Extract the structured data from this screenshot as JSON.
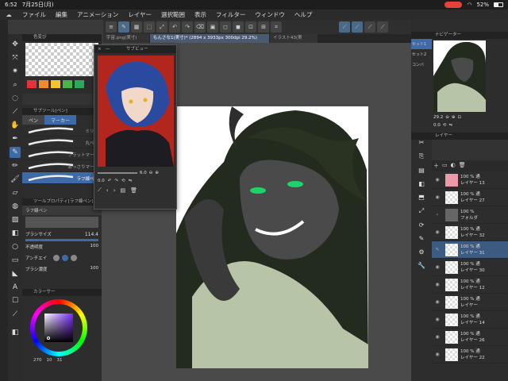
{
  "status": {
    "time": "6:52",
    "date": "7月25日(月)",
    "battery": "52%"
  },
  "menu": [
    "ファイル",
    "編集",
    "アニメーション",
    "レイヤー",
    "選択範囲",
    "表示",
    "フィルター",
    "ウィンドウ",
    "ヘルプ"
  ],
  "tabs": [
    "宇宙.png(実寸)",
    "もんさな1(実寸)* (2894 x 3933px 300dpi 29.2%)",
    "イラスト43(実"
  ],
  "color_set": {
    "title": "色変び",
    "swatches": [
      "#e8303a",
      "#f08a2c",
      "#f3c531",
      "#48b64a",
      "#2aa95b"
    ]
  },
  "subtool": {
    "title": "サブツール[ペン]",
    "tabs": [
      "ペン",
      "マーカー"
    ],
    "brushes": [
      "ミリペ",
      "丸ペン",
      "フラットマーカ",
      "あっさりマーカ",
      "ラフ線ペン"
    ]
  },
  "tool_property": {
    "title": "ツールプロパティ[ラフ線ペン]",
    "name": "ラフ線ペン",
    "brush_size_label": "ブラシサイズ",
    "brush_size": "114.4",
    "opacity_label": "不透明度",
    "opacity": "100",
    "antialias_label": "アンチエイ",
    "density_label": "ブラシ濃度",
    "density": "100"
  },
  "color_wheel": {
    "title": "カラーサー",
    "h": "270",
    "s": "10",
    "v": "31"
  },
  "subview": {
    "title": "サブビュー",
    "zoom": "6.0",
    "rot": "0.0"
  },
  "navigator": {
    "title": "ナビゲーター",
    "zoom": "29.2",
    "rot": "0.0",
    "set_tabs": [
      "セット1",
      "セット2",
      "コンバ"
    ]
  },
  "layers": {
    "title": "レイヤー",
    "items": [
      {
        "op": "100 %",
        "mode": "通",
        "name": "レイヤー 13",
        "color": "#e9a"
      },
      {
        "op": "100 %",
        "mode": "通",
        "name": "レイヤー 27"
      },
      {
        "op": "100 %",
        "mode": "",
        "name": "フォルダ",
        "folder": true
      },
      {
        "op": "100 %",
        "mode": "通",
        "name": "レイヤー 32"
      },
      {
        "op": "100 %",
        "mode": "通",
        "name": "レイヤー 31",
        "active": true
      },
      {
        "op": "100 %",
        "mode": "通",
        "name": "レイヤー 30"
      },
      {
        "op": "100 %",
        "mode": "通",
        "name": "レイヤー 12"
      },
      {
        "op": "100 %",
        "mode": "通",
        "name": "レイヤー"
      },
      {
        "op": "100 %",
        "mode": "通",
        "name": "レイヤー 14"
      },
      {
        "op": "100 %",
        "mode": "通",
        "name": "レイヤー 26"
      },
      {
        "op": "100 %",
        "mode": "通",
        "name": "レイヤー 22"
      }
    ]
  },
  "colors": {
    "accent": "#3e6aa8",
    "canvas_bg": "#4a4a4a",
    "skin": "#b8c4a8",
    "hair": "#232a1e",
    "subview_bg": "#b3261e",
    "subview_hair": "#2a4aa0"
  }
}
